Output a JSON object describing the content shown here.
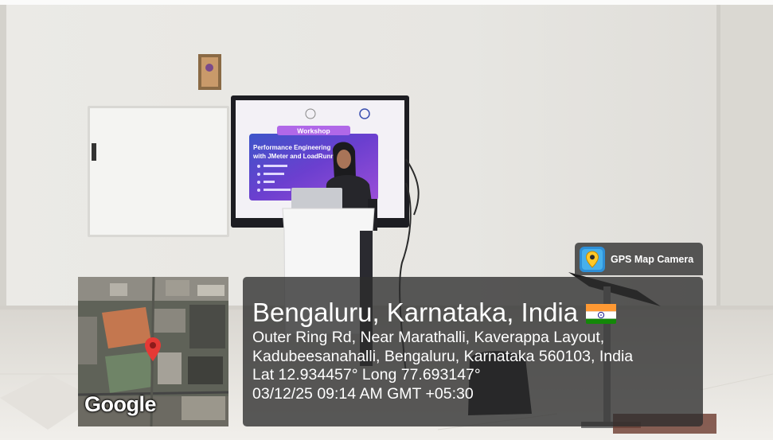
{
  "badge": {
    "label": "GPS Map Camera",
    "icon": "map-pin-camera-icon"
  },
  "location": {
    "title": "Bengaluru, Karnataka, India",
    "flag": "india-flag-icon",
    "address_line1": "Outer Ring Rd, Near Marathalli, Kaverappa Layout,",
    "address_line2": "Kadubeesanahalli, Bengaluru, Karnataka 560103, India",
    "coordinates": "Lat 12.934457° Long 77.693147°",
    "timestamp": "03/12/25 09:14 AM GMT +05:30"
  },
  "map": {
    "logo": "Google",
    "pin_color": "#e53935"
  },
  "screen": {
    "heading": "Workshop",
    "title_line1": "Performance Engineering",
    "title_line2": "with JMeter and LoadRunner"
  },
  "colors": {
    "panel": "#2d2d2d",
    "text": "#ffffff",
    "slide_bg": "#5b3fc4"
  }
}
